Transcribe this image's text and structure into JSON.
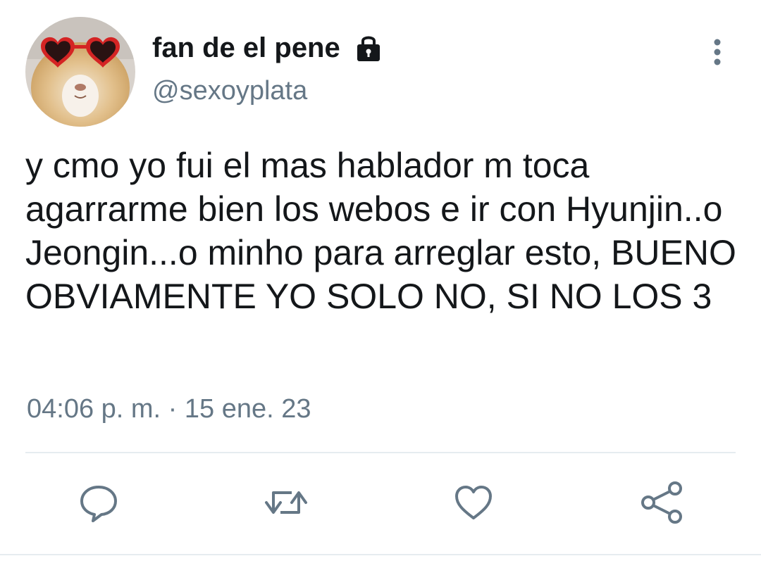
{
  "user": {
    "display_name": "fan de el pene",
    "handle": "@sexoyplata",
    "protected_icon": "lock-icon",
    "avatar_description_icon": "guinea-pig-with-heart-sunglasses"
  },
  "tweet": {
    "text": "y cmo yo fui el mas hablador m toca agarrarme bien los webos e ir con Hyunjin..o Jeongin...o minho para arreglar esto, BUENO OBVIAMENTE YO SOLO NO, SI NO LOS 3",
    "time": "04:06 p. m.",
    "separator": " · ",
    "date": "15 ene. 23"
  },
  "actions": {
    "icons": [
      "reply-icon",
      "retweet-icon",
      "like-icon",
      "share-icon"
    ]
  },
  "colors": {
    "text": "#14171a",
    "secondary": "#657786",
    "divider": "#e6ecf0"
  }
}
